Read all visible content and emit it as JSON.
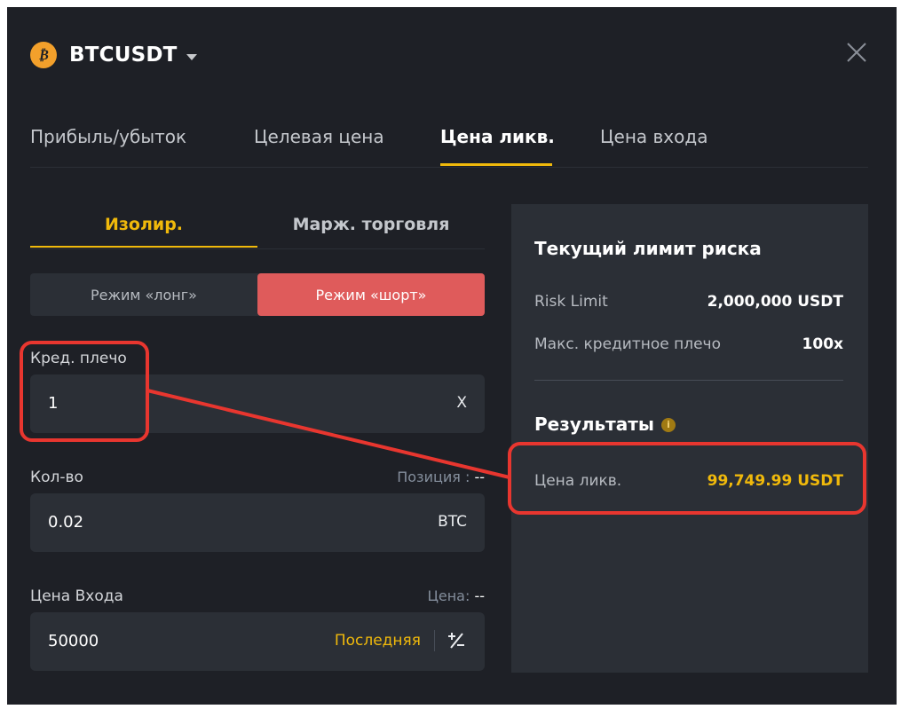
{
  "header": {
    "coin_glyph": "₿",
    "symbol": "BTCUSDT"
  },
  "tabs": [
    {
      "label": "Прибыль/убыток"
    },
    {
      "label": "Целевая цена"
    },
    {
      "label": "Цена ликв."
    },
    {
      "label": "Цена входа"
    }
  ],
  "active_tab": "Цена ликв.",
  "margin_tabs": {
    "isolated": "Изолир.",
    "cross": "Марж. торговля"
  },
  "mode": {
    "long": "Режим «лонг»",
    "short": "Режим «шорт»",
    "selected": "short"
  },
  "leverage": {
    "label": "Кред. плечо",
    "value": "1",
    "unit": "X"
  },
  "quantity": {
    "label": "Кол-во",
    "aux_label": "Позиция :",
    "aux_value": "--",
    "value": "0.02",
    "unit": "BTC"
  },
  "entry_price": {
    "label": "Цена Входа",
    "aux_label": "Цена:",
    "aux_value": "--",
    "value": "50000",
    "last_label": "Последняя"
  },
  "risk": {
    "title": "Текущий лимит риска",
    "rows": [
      {
        "label": "Risk Limit",
        "value": "2,000,000 USDT"
      },
      {
        "label": "Макс. кредитное плечо",
        "value": "100x"
      }
    ]
  },
  "results": {
    "title": "Результаты",
    "info_glyph": "i",
    "liq_label": "Цена ликв.",
    "liq_value": "99,749.99 USDT"
  },
  "colors": {
    "background": "#1e2026",
    "panel": "#2b2f36",
    "accent": "#f0b90b",
    "short": "#df5b5b",
    "annotation": "#e8362f"
  }
}
